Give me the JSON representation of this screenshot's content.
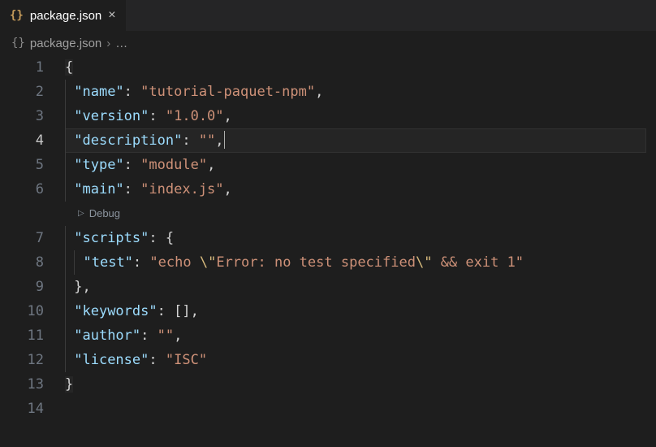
{
  "tab": {
    "filename": "package.json",
    "icon": "{}",
    "close_glyph": "×"
  },
  "breadcrumb": {
    "filename": "package.json",
    "separator": "›",
    "trail": "…",
    "icon": "{}"
  },
  "codelens": {
    "label": "Debug",
    "glyph": "▷"
  },
  "lines": {
    "l1": "1",
    "l2": "2",
    "l3": "3",
    "l4": "4",
    "l5": "5",
    "l6": "6",
    "l7": "7",
    "l8": "8",
    "l9": "9",
    "l10": "10",
    "l11": "11",
    "l12": "12",
    "l13": "13",
    "l14": "14"
  },
  "json": {
    "open": "{",
    "close": "}",
    "name_key": "\"name\"",
    "name_val": "\"tutorial-paquet-npm\"",
    "version_key": "\"version\"",
    "version_val": "\"1.0.0\"",
    "description_key": "\"description\"",
    "description_val": "\"\"",
    "type_key": "\"type\"",
    "type_val": "\"module\"",
    "main_key": "\"main\"",
    "main_val": "\"index.js\"",
    "scripts_key": "\"scripts\"",
    "scripts_open": "{",
    "scripts_close": "}",
    "test_key": "\"test\"",
    "test_val_pre": "\"echo ",
    "test_esc1": "\\\"",
    "test_val_mid": "Error: no test specified",
    "test_esc2": "\\\"",
    "test_val_post": " && exit 1\"",
    "keywords_key": "\"keywords\"",
    "keywords_val": "[]",
    "author_key": "\"author\"",
    "author_val": "\"\"",
    "license_key": "\"license\"",
    "license_val": "\"ISC\"",
    "colon": ":",
    "comma": ","
  }
}
